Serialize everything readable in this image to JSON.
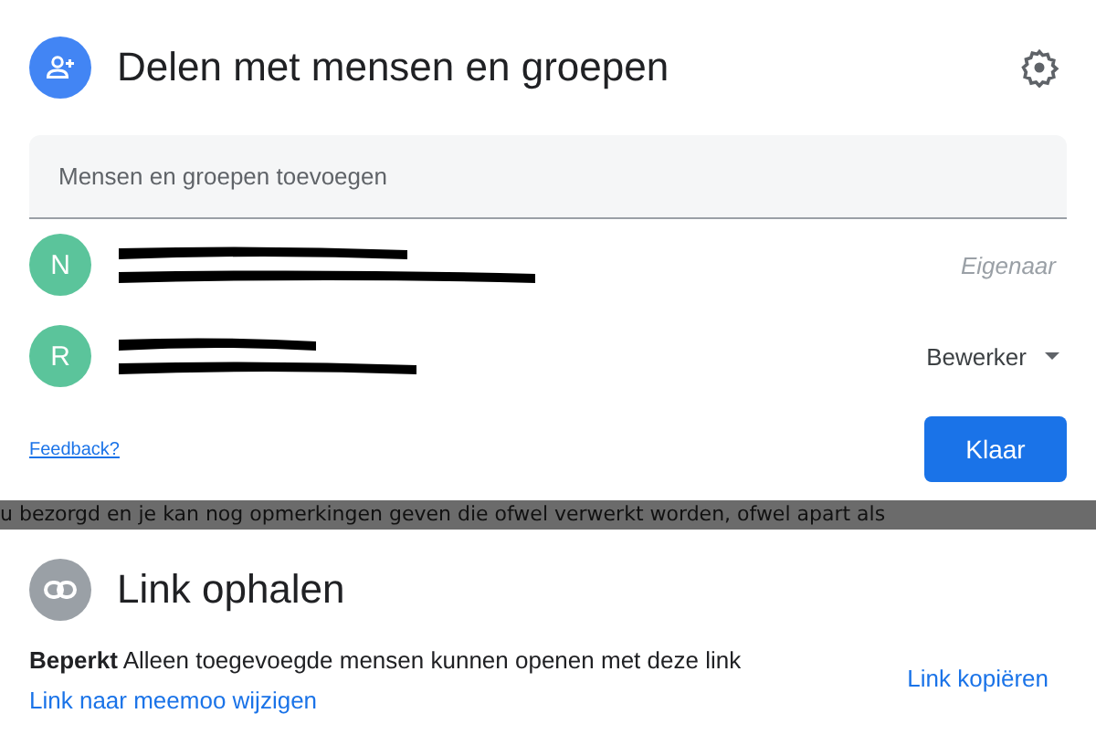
{
  "share_dialog": {
    "title": "Delen met mensen en groepen",
    "add_field": {
      "placeholder": "Mensen en groepen toevoegen"
    },
    "people": [
      {
        "initial": "N",
        "color": "#5bc49b",
        "role": "Eigenaar",
        "kind": "owner"
      },
      {
        "initial": "R",
        "color": "#5bc49b",
        "role": "Bewerker",
        "kind": "editor"
      }
    ],
    "feedback_link": "Feedback?",
    "done_button": "Klaar"
  },
  "background_text": "u bezorgd en je kan nog opmerkingen geven die ofwel verwerkt worden, ofwel apart als",
  "link_dialog": {
    "title": "Link ophalen",
    "access": "Beperkt",
    "description": "Alleen toegevoegde mensen kunnen openen met deze link",
    "change_link": "Link naar meemoo wijzigen",
    "copy_link": "Link kopiëren"
  }
}
